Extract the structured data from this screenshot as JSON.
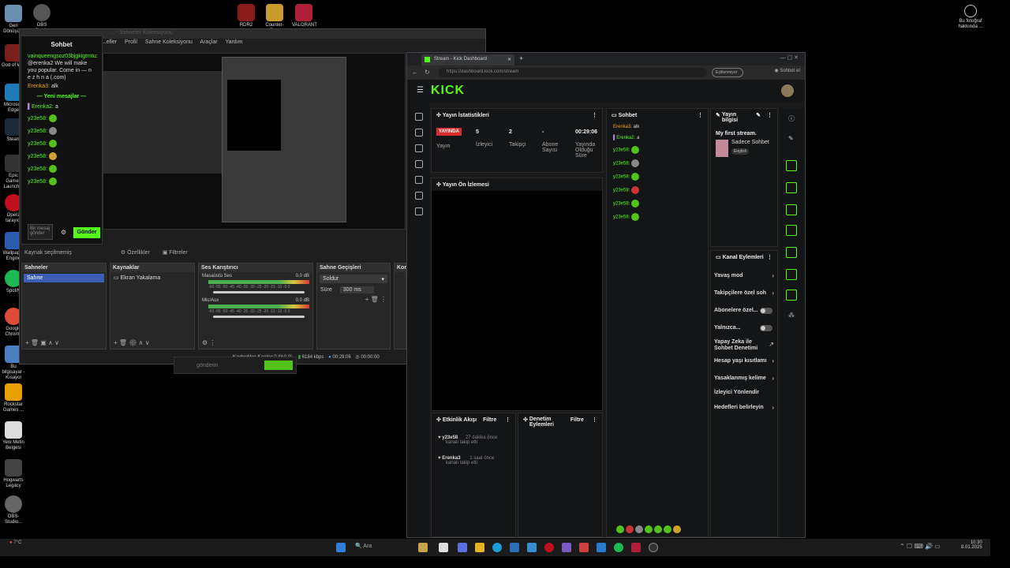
{
  "desktop": {
    "icons_left": [
      "Geri Dönüşüm",
      "God of W...",
      "Microsoft Edge",
      "Steam",
      "Epic Games Launcher",
      "Opera tarayıcı",
      "Wallpaper Engine",
      "Spotify",
      "Google Chrome",
      "Bu bilgisayar - Kısayol",
      "Rockstar Games ...",
      "Yeni Metin Belgesi",
      "Hogwarts Legacy",
      "OBS-Studio..."
    ],
    "icons_top": [
      "OBS Studio",
      "RDR2",
      "Counter-Str...",
      "VALORANT"
    ],
    "photo_info": "Bu fotoğraf hakkında ..."
  },
  "chat_popup": {
    "title": "Sohbet",
    "messages": [
      {
        "user": "vainqueengsoz03bjgkigtmtu",
        "text": ": @erenka2 We will make you popular. Come in — n e z h n a (.com)"
      },
      {
        "user": "Erenka3:",
        "text": " alk"
      }
    ],
    "new_messages": "Yeni mesajlar",
    "after": [
      {
        "user": "Erenka2:",
        "text": " a"
      },
      {
        "user": "y23e58:",
        "text": ""
      },
      {
        "user": "y23e58:",
        "text": ""
      },
      {
        "user": "y23e58:",
        "text": ""
      },
      {
        "user": "y23e58:",
        "text": ""
      },
      {
        "user": "y23e58:",
        "text": ""
      },
      {
        "user": "y23e58:",
        "text": ""
      }
    ],
    "input_placeholder": "Bir mesaj gönder",
    "send": "Gönder"
  },
  "obs": {
    "menu": [
      "...eller",
      "Profil",
      "Sahne Koleksiyonu",
      "Araçlar",
      "Yardım"
    ],
    "title_ghost": "... - Sahneler Koleksiyonu",
    "source_bar": {
      "none_selected": "Kaynak seçilmemiş",
      "properties": "Özellikler",
      "filters": "Filtreler"
    },
    "scenes": {
      "header": "Sahneler",
      "items": [
        "Sahne"
      ]
    },
    "sources": {
      "header": "Kaynaklar",
      "items": [
        "Ekran Yakalama"
      ]
    },
    "mixer": {
      "header": "Ses Karıştırıcı",
      "channels": [
        {
          "name": "Masaüstü Ses",
          "db": "0.0 dB"
        },
        {
          "name": "Mic/Aux",
          "db": "0.0 dB"
        }
      ],
      "ticks": "-60 -55 -50 -45 -40 -35 -30 -25 -20 -15 -10 -5 0"
    },
    "transitions": {
      "header": "Sahne Geçişleri",
      "selected": "Soldur",
      "duration_label": "Süre",
      "duration": "300 ms"
    },
    "controls_header": "Kon",
    "status": {
      "dropped": "Kaybedilen Kareler 0 (%0.0)",
      "bitrate": "6184 kbps",
      "live_time": "00:29:06",
      "rec_time": "00:00:00"
    }
  },
  "ghost_send": "gönderin",
  "browser": {
    "tab_title": "Stream - Kick Dashboard",
    "url": "https://dashboard.kick.com/stream",
    "sync": "Eşitlenmiyor",
    "sohbet_btn": "Sohbet et"
  },
  "kick": {
    "logo": "KICK",
    "stats": {
      "header": "Yayın İstatistikleri",
      "live_badge": "YAYINDA",
      "status_label": "Yayın",
      "viewers_value": "5",
      "viewers_label": "İzleyici",
      "followers_value": "2",
      "followers_label": "Takipçi",
      "subs_value": "-",
      "subs_label": "Abone Sayısı",
      "duration_value": "00:29:06",
      "duration_label": "Yayında Olduğu Süre"
    },
    "preview_header": "Yayın Ön İzlemesi",
    "activity": {
      "header": "Etkinlik Akışı",
      "filter": "Filtre",
      "items": [
        {
          "user": "y23e58",
          "time": "27 dakika önce",
          "desc": "kanalı takip etti"
        },
        {
          "user": "Erenka3",
          "time": "1 saat önce",
          "desc": "kanalı takip etti"
        }
      ]
    },
    "mod_actions": {
      "header": "Denetim Eylemleri",
      "filter": "Filtre"
    },
    "chat": {
      "header": "Sohbet",
      "messages": [
        {
          "user": "Erenka3:",
          "text": " alk"
        },
        {
          "user": "Erenka2:",
          "text": " a"
        },
        {
          "user": "y23e58:",
          "text": ""
        },
        {
          "user": "y23e58:",
          "text": ""
        },
        {
          "user": "y23e58:",
          "text": ""
        },
        {
          "user": "y23e58:",
          "text": ""
        },
        {
          "user": "y23e58:",
          "text": ""
        },
        {
          "user": "y23e58:",
          "text": ""
        }
      ]
    },
    "stream_info": {
      "header": "Yayın bilgisi",
      "title": "My first stream.",
      "category": "Sadece Sohbet",
      "language": "English"
    },
    "channel_actions": {
      "header": "Kanal Eylemleri",
      "items": [
        {
          "label": "Yavaş mod",
          "kind": "chevron"
        },
        {
          "label": "Takipçilere özel soh",
          "kind": "chevron"
        },
        {
          "label": "Abonelere özel...",
          "kind": "toggle"
        },
        {
          "label": "Yalnızca...",
          "kind": "toggle"
        },
        {
          "label": "Yapay Zeka ile Sohbet Denetimi",
          "kind": "link"
        },
        {
          "label": "Hesap yaşı kısıtlamı",
          "kind": "chevron"
        },
        {
          "label": "Yasaklanmış kelime",
          "kind": "chevron"
        },
        {
          "label": "İzleyici Yönlendir",
          "kind": "none"
        },
        {
          "label": "Hedefleri belirleyin",
          "kind": "chevron"
        }
      ]
    }
  },
  "taskbar": {
    "search": "Ara",
    "weather": "7°C",
    "time": "10:30",
    "date": "8.01.2025"
  }
}
